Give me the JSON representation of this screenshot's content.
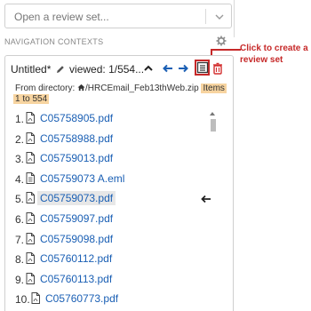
{
  "review_set_select": {
    "placeholder": "Open a review set..."
  },
  "section": {
    "label": "NAVIGATION CONTEXTS"
  },
  "annotation": {
    "text": "Click to create a review set"
  },
  "context": {
    "title": "Untitled*",
    "viewed_text": "viewed: 1/554...",
    "from_prefix": "From directory:",
    "directory": "/HRCEmail_Feb13thWeb.zip",
    "items_badge_line1": "Items",
    "items_badge_line2": "1 to 554"
  },
  "files": [
    {
      "num": "1.",
      "name": "C05758905.pdf",
      "icon": "pdf-file-icon",
      "selected": false
    },
    {
      "num": "2.",
      "name": "C05758988.pdf",
      "icon": "pdf-file-icon",
      "selected": false
    },
    {
      "num": "3.",
      "name": "C05759013.pdf",
      "icon": "pdf-file-icon",
      "selected": false
    },
    {
      "num": "4.",
      "name": "C05759073 A.eml",
      "icon": "email-file-icon",
      "selected": false
    },
    {
      "num": "5.",
      "name": "C05759073.pdf",
      "icon": "pdf-file-icon",
      "selected": true
    },
    {
      "num": "6.",
      "name": "C05759097.pdf",
      "icon": "pdf-file-icon",
      "selected": false
    },
    {
      "num": "7.",
      "name": "C05759098.pdf",
      "icon": "pdf-file-icon",
      "selected": false
    },
    {
      "num": "8.",
      "name": "C05760112.pdf",
      "icon": "pdf-file-icon",
      "selected": false
    },
    {
      "num": "9.",
      "name": "C05760113.pdf",
      "icon": "pdf-file-icon",
      "selected": false
    },
    {
      "num": "10.",
      "name": "C05760773.pdf",
      "icon": "pdf-file-icon",
      "selected": false
    }
  ],
  "colors": {
    "accent": "#1a5fb4",
    "annotation": "#c62828",
    "badge": "#f7d4a0",
    "delete": "#d32f2f"
  }
}
